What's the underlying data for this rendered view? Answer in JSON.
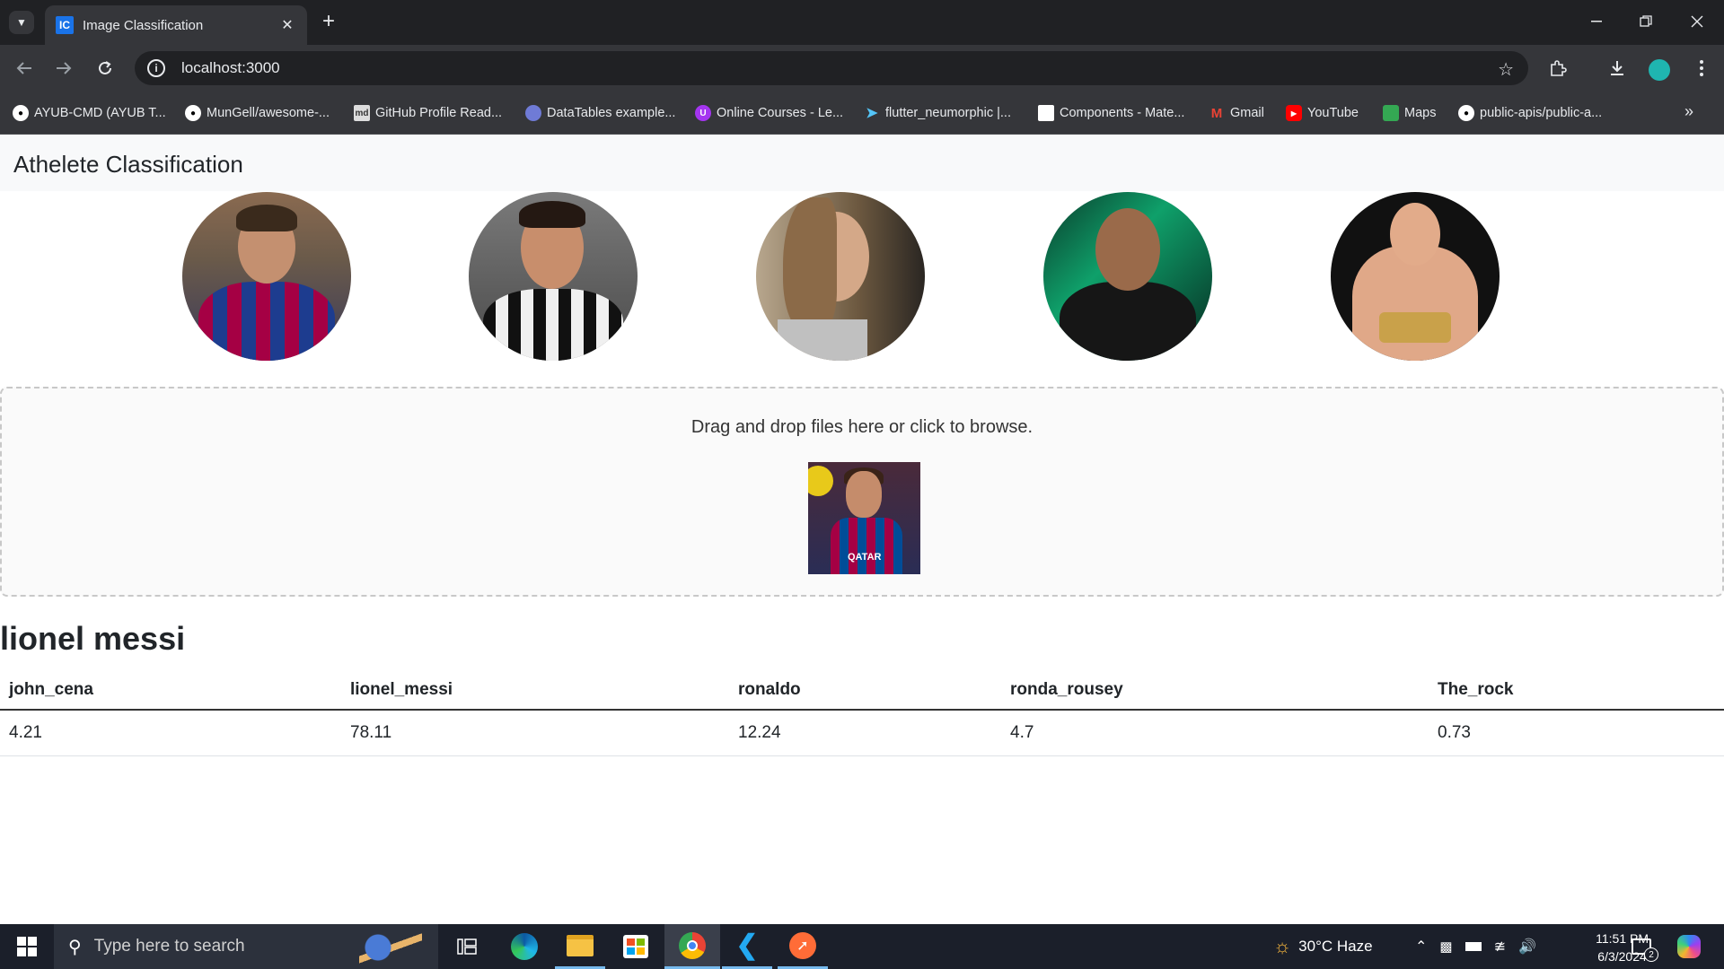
{
  "browser": {
    "tab_title": "Image Classification",
    "tab_favicon_text": "IC",
    "url": "localhost:3000",
    "bookmarks": [
      {
        "label": "AYUB-CMD (AYUB T...",
        "icon": "github-icon"
      },
      {
        "label": "MunGell/awesome-...",
        "icon": "github-icon"
      },
      {
        "label": "GitHub Profile Read...",
        "icon": "readme-icon"
      },
      {
        "label": "DataTables example...",
        "icon": "datatables-icon"
      },
      {
        "label": "Online Courses - Le...",
        "icon": "courses-icon"
      },
      {
        "label": "flutter_neumorphic |...",
        "icon": "flutter-icon"
      },
      {
        "label": "Components - Mate...",
        "icon": "material-icon"
      },
      {
        "label": "Gmail",
        "icon": "gmail-icon"
      },
      {
        "label": "YouTube",
        "icon": "youtube-icon"
      },
      {
        "label": "Maps",
        "icon": "maps-icon"
      },
      {
        "label": "public-apis/public-a...",
        "icon": "github-icon"
      }
    ]
  },
  "app": {
    "title": "Athelete Classification",
    "athletes": [
      {
        "name": "lionel messi"
      },
      {
        "name": "ronaldo"
      },
      {
        "name": "ronda rousey"
      },
      {
        "name": "the rock"
      },
      {
        "name": "john cena"
      }
    ],
    "dropzone_text": "Drag and drop files here or click to browse.",
    "thumb_text": "QATAR",
    "result_title": "lionel messi",
    "table": {
      "headers": [
        "john_cena",
        "lionel_messi",
        "ronaldo",
        "ronda_rousey",
        "The_rock"
      ],
      "rows": [
        [
          "4.21",
          "78.11",
          "12.24",
          "4.7",
          "0.73"
        ]
      ]
    }
  },
  "taskbar": {
    "search_placeholder": "Type here to search",
    "weather": "30°C  Haze",
    "time": "11:51 PM",
    "date": "6/3/2024",
    "notification_count": "2"
  }
}
